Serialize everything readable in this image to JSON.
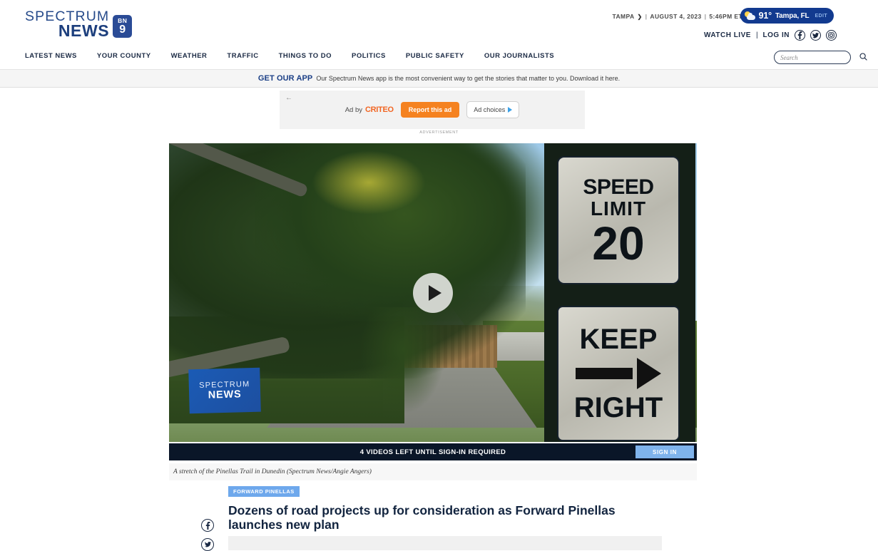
{
  "site": {
    "brand_line1": "SPECTRUM",
    "brand_line2": "NEWS",
    "badge_top": "BN",
    "badge_bottom": "9",
    "brand_color": "#1d3f7d"
  },
  "header": {
    "region": "TAMPA",
    "region_chevron": "❯",
    "sep1": "|",
    "date": "AUGUST 4, 2023",
    "sep2": "|",
    "time": "5:46PM ET",
    "weather": {
      "temperature": "91°",
      "location": "Tampa, FL",
      "edit_label": "EDIT",
      "icon": "sun-cloud-icon",
      "pill_color": "#123a8f"
    },
    "watch_live": "WATCH LIVE",
    "divider": "|",
    "log_in": "LOG IN",
    "social": [
      {
        "name": "facebook-icon"
      },
      {
        "name": "twitter-icon"
      },
      {
        "name": "instagram-icon"
      }
    ]
  },
  "nav": {
    "items": [
      {
        "label": "LATEST NEWS"
      },
      {
        "label": "YOUR COUNTY"
      },
      {
        "label": "WEATHER"
      },
      {
        "label": "TRAFFIC"
      },
      {
        "label": "THINGS TO DO"
      },
      {
        "label": "POLITICS"
      },
      {
        "label": "PUBLIC SAFETY"
      },
      {
        "label": "OUR JOURNALISTS"
      }
    ],
    "search_placeholder": "Search",
    "search_value": ""
  },
  "app_banner": {
    "strong": "GET OUR APP",
    "text": "Our Spectrum News app is the most convenient way to get the stories that matter to you. Download it here."
  },
  "ad": {
    "back_arrow": "←",
    "ad_by": "Ad by",
    "network": "CRITEO",
    "report_label": "Report this ad",
    "choices_label": "Ad choices",
    "advertisement_label": "ADVERTISEMENT",
    "report_color": "#f58220"
  },
  "video": {
    "play_button": "play-icon",
    "watermark_line1": "SPECTRUM",
    "watermark_line2": "NEWS",
    "sign_speed_line1": "SPEED",
    "sign_speed_line2": "LIMIT",
    "sign_speed_value": "20",
    "sign_keep_line1": "KEEP",
    "sign_keep_line2": "RIGHT",
    "bar_text": "4 VIDEOS LEFT UNTIL SIGN-IN REQUIRED",
    "sign_in_label": "SIGN IN",
    "caption": "A stretch of the Pinellas Trail in Dunedin (Spectrum News/Angie Angers)"
  },
  "article": {
    "tag": "FORWARD PINELLAS",
    "headline": "Dozens of road projects up for consideration as Forward Pinellas launches new plan",
    "share": [
      {
        "name": "facebook-share-icon"
      },
      {
        "name": "twitter-share-icon"
      }
    ]
  }
}
